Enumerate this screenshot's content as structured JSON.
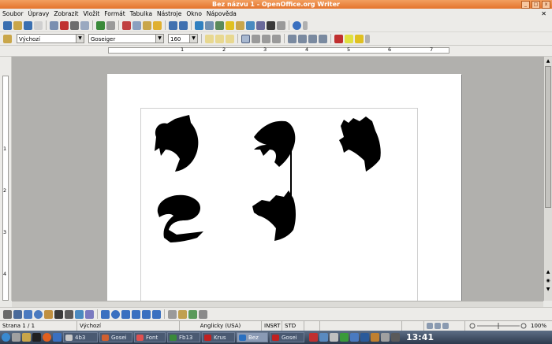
{
  "window": {
    "title": "Bez názvu 1 - OpenOffice.org Writer"
  },
  "menu": [
    "Soubor",
    "Úpravy",
    "Zobrazit",
    "Vložit",
    "Formát",
    "Tabulka",
    "Nástroje",
    "Okno",
    "Nápověda"
  ],
  "format": {
    "style": "Výchozí",
    "font": "Goseiger",
    "size": "160"
  },
  "ruler": {
    "h": [
      "1",
      "2",
      "3",
      "4",
      "5",
      "6",
      "7"
    ],
    "v": [
      "1",
      "2",
      "3",
      "4"
    ]
  },
  "status": {
    "page": "Strana 1 / 1",
    "style": "Výchozí",
    "language": "Anglicky (USA)",
    "insert": "INSRT",
    "selection": "STD",
    "zoom": "100%"
  },
  "taskbar": {
    "tasks": [
      {
        "label": "4b3",
        "color": "#c8c8c8"
      },
      {
        "label": "Gosei",
        "color": "#d06030"
      },
      {
        "label": "Font",
        "color": "#e05050"
      },
      {
        "label": "Fb13",
        "color": "#3a8a3a"
      },
      {
        "label": "Krus",
        "color": "#c02020"
      },
      {
        "label": "Bez",
        "color": "#2a70c0"
      },
      {
        "label": "Gosei",
        "color": "#c02020"
      }
    ],
    "clock": "13:41"
  },
  "colors": {
    "titlebar": "#e4742d",
    "accent": "#2a70c0"
  }
}
